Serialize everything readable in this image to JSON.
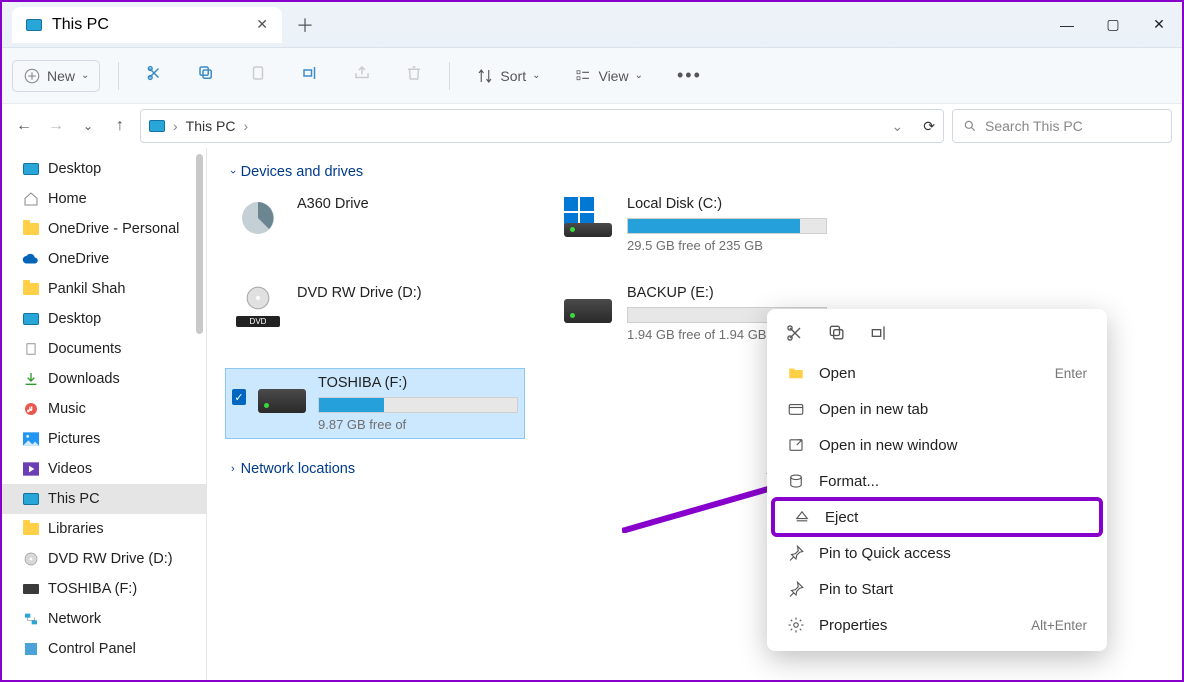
{
  "title": "This PC",
  "window_buttons": {
    "min": "—",
    "max": "▢",
    "close": "✕"
  },
  "toolbar": {
    "new": "New",
    "sort": "Sort",
    "view": "View"
  },
  "nav": {
    "breadcrumb": "This PC",
    "search_placeholder": "Search This PC"
  },
  "sidebar": [
    {
      "label": "Desktop",
      "icon": "monitor"
    },
    {
      "label": "Home",
      "icon": "home"
    },
    {
      "label": "OneDrive - Personal",
      "icon": "folder"
    },
    {
      "label": "OneDrive",
      "icon": "cloud"
    },
    {
      "label": "Pankil Shah",
      "icon": "folder"
    },
    {
      "label": "Desktop",
      "icon": "monitor"
    },
    {
      "label": "Documents",
      "icon": "doc"
    },
    {
      "label": "Downloads",
      "icon": "download"
    },
    {
      "label": "Music",
      "icon": "music"
    },
    {
      "label": "Pictures",
      "icon": "picture"
    },
    {
      "label": "Videos",
      "icon": "video"
    },
    {
      "label": "This PC",
      "icon": "monitor",
      "active": true
    },
    {
      "label": "Libraries",
      "icon": "folder"
    },
    {
      "label": "DVD RW Drive (D:)",
      "icon": "dvd"
    },
    {
      "label": "TOSHIBA (F:)",
      "icon": "usb"
    },
    {
      "label": "Network",
      "icon": "network"
    },
    {
      "label": "Control Panel",
      "icon": "control"
    }
  ],
  "groups": {
    "devices": "Devices and drives",
    "network": "Network locations"
  },
  "drives": [
    {
      "name": "A360 Drive",
      "free": "",
      "fill": 0,
      "nobar": true,
      "icon": "a360"
    },
    {
      "name": "Local Disk (C:)",
      "free": "29.5 GB free of 235 GB",
      "fill": 87,
      "icon": "win"
    },
    {
      "name": "DVD RW Drive (D:)",
      "free": "",
      "fill": 0,
      "nobar": true,
      "icon": "dvd"
    },
    {
      "name": "BACKUP (E:)",
      "free": "1.94 GB free of 1.94 GB",
      "fill": 0,
      "icon": "hdd"
    },
    {
      "name": "TOSHIBA (F:)",
      "free": "9.87 GB free of",
      "fill": 33,
      "icon": "hdd",
      "selected": true
    }
  ],
  "context_menu": {
    "items": [
      {
        "label": "Open",
        "shortcut": "Enter",
        "icon": "folder"
      },
      {
        "label": "Open in new tab",
        "shortcut": "",
        "icon": "tab"
      },
      {
        "label": "Open in new window",
        "shortcut": "",
        "icon": "window"
      },
      {
        "label": "Format...",
        "shortcut": "",
        "icon": "format"
      },
      {
        "label": "Eject",
        "shortcut": "",
        "icon": "eject",
        "highlight": true
      },
      {
        "label": "Pin to Quick access",
        "shortcut": "",
        "icon": "pin"
      },
      {
        "label": "Pin to Start",
        "shortcut": "",
        "icon": "pin"
      },
      {
        "label": "Properties",
        "shortcut": "Alt+Enter",
        "icon": "props"
      }
    ]
  }
}
